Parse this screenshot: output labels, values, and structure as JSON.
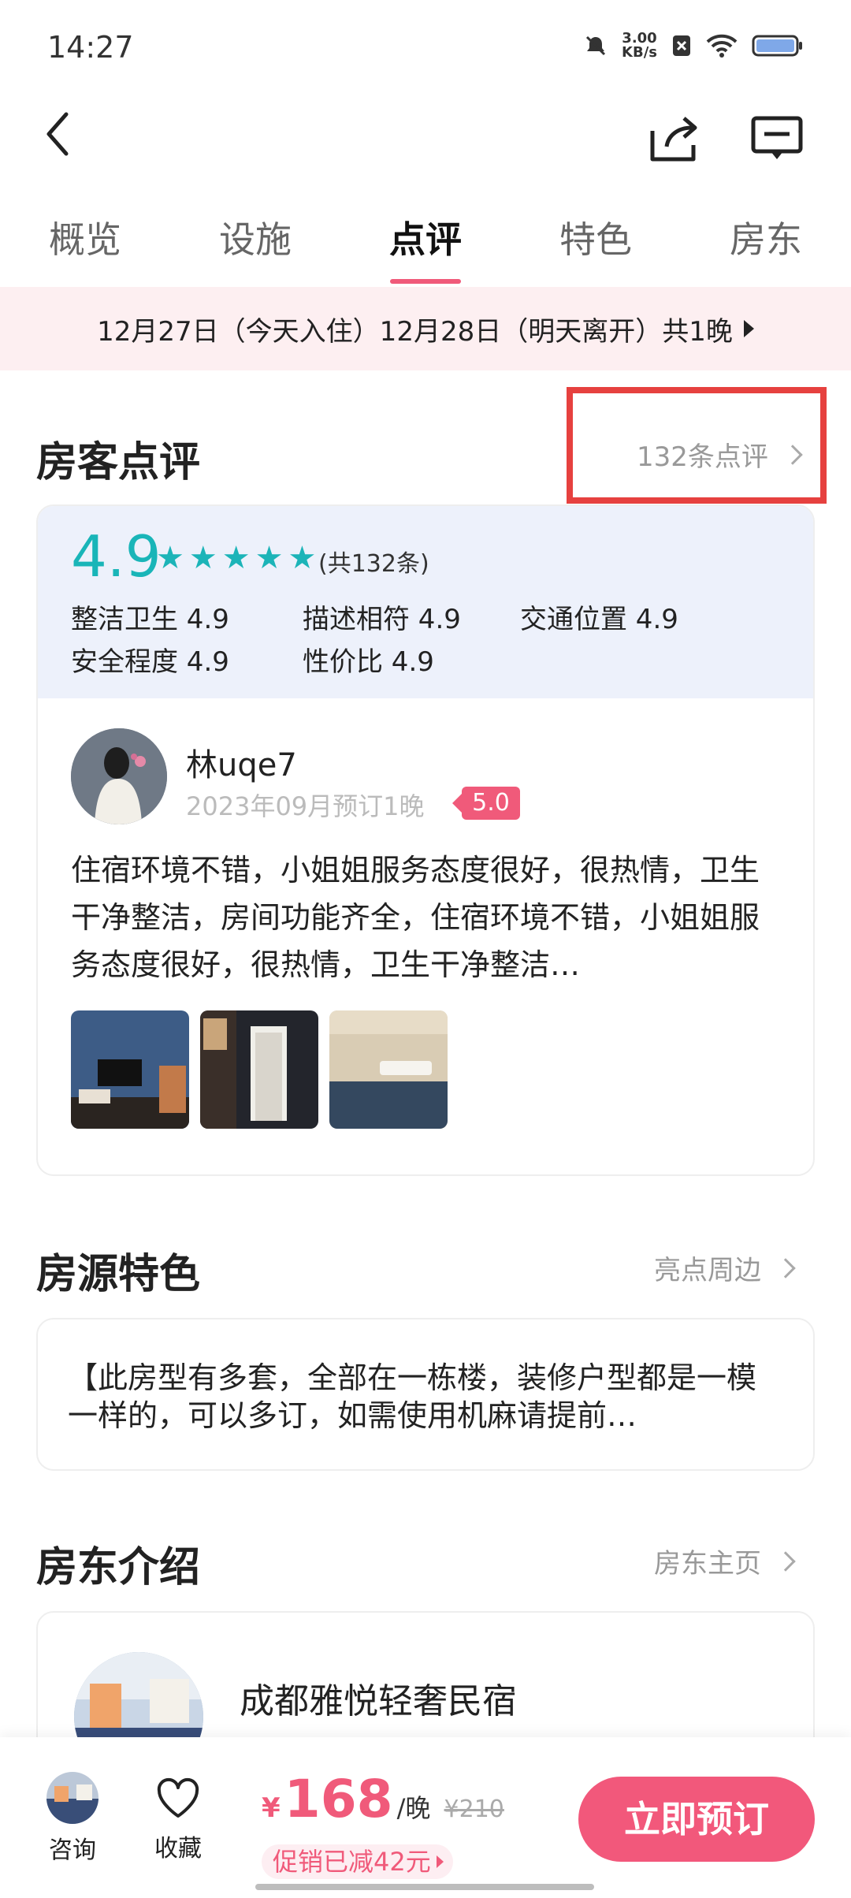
{
  "status_bar": {
    "time": "14:27",
    "net_speed_value": "3.00",
    "net_speed_unit": "KB/s"
  },
  "tabs": [
    "概览",
    "设施",
    "点评",
    "特色",
    "房东"
  ],
  "active_tab": "点评",
  "date_banner": "12月27日（今天入住）12月28日（明天离开）共1晚",
  "reviews_section": {
    "title": "房客点评",
    "link": "132条点评",
    "overall_score": "4.9",
    "star_count": 5,
    "total": "(共132条)",
    "sub_scores": [
      "整洁卫生 4.9",
      "描述相符 4.9",
      "交通位置 4.9",
      "安全程度 4.9",
      "性价比 4.9"
    ],
    "review": {
      "name": "林uqe7",
      "meta": "2023年09月预订1晚",
      "rating": "5.0",
      "text": "住宿环境不错，小姐姐服务态度很好，很热情，卫生干净整洁，房间功能齐全，住宿环境不错，小姐姐服务态度很好，很热情，卫生干净整洁…"
    }
  },
  "feature_section": {
    "title": "房源特色",
    "link": "亮点周边",
    "text": "【此房型有多套，全部在一栋楼，装修户型都是一模一样的，可以多订，如需使用机麻请提前…"
  },
  "host_section": {
    "title": "房东介绍",
    "link": "房东主页",
    "host_name": "成都雅悦轻奢民宿"
  },
  "bottom_bar": {
    "consult": "咨询",
    "favorite": "收藏",
    "currency": "¥",
    "price": "168",
    "per_night": "/晚",
    "original_price": "¥210",
    "promo": "促销已减42元",
    "book": "立即预订"
  },
  "colors": {
    "accent": "#f05a7a",
    "score": "#19b5b8",
    "banner_bg": "#fdeff1",
    "score_panel_bg": "#edf1fb",
    "highlight": "#e6413f"
  }
}
